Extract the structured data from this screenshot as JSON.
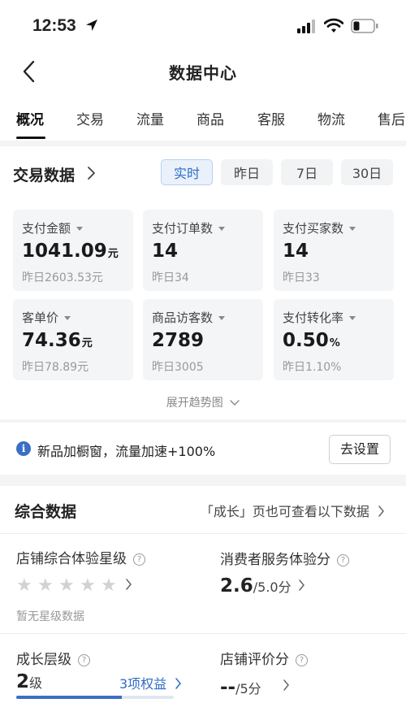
{
  "status_bar": {
    "time": "12:53"
  },
  "header": {
    "title": "数据中心"
  },
  "tabs": [
    {
      "label": "概况",
      "active": true
    },
    {
      "label": "交易",
      "active": false
    },
    {
      "label": "流量",
      "active": false
    },
    {
      "label": "商品",
      "active": false
    },
    {
      "label": "客服",
      "active": false
    },
    {
      "label": "物流",
      "active": false
    },
    {
      "label": "售后",
      "active": false
    }
  ],
  "trade": {
    "title": "交易数据",
    "ranges": [
      "实时",
      "昨日",
      "7日",
      "30日"
    ],
    "active_range": "实时",
    "metrics": [
      {
        "label": "支付金额",
        "value": "1041.09",
        "unit": "元",
        "prev": "昨日2603.53元"
      },
      {
        "label": "支付订单数",
        "value": "14",
        "unit": "",
        "prev": "昨日34"
      },
      {
        "label": "支付买家数",
        "value": "14",
        "unit": "",
        "prev": "昨日33"
      },
      {
        "label": "客单价",
        "value": "74.36",
        "unit": "元",
        "prev": "昨日78.89元"
      },
      {
        "label": "商品访客数",
        "value": "2789",
        "unit": "",
        "prev": "昨日3005"
      },
      {
        "label": "支付转化率",
        "value": "0.50",
        "unit": "%",
        "prev": "昨日1.10%"
      }
    ],
    "expand_label": "展开趋势图"
  },
  "notice": {
    "icon": "info-icon",
    "text": "新品加橱窗，流量加速+100%",
    "button": "去设置"
  },
  "overall": {
    "title": "综合数据",
    "hint": "「成长」页也可查看以下数据",
    "shop_rating": {
      "label": "店铺综合体验星级",
      "stars": 0,
      "max_stars": 5,
      "note": "暂无星级数据"
    },
    "service_score": {
      "label": "消费者服务体验分",
      "value": "2.6",
      "unit": "/5.0分"
    },
    "growth": {
      "label": "成长层级",
      "level": "2",
      "unit": "级",
      "benefits": "3项权益",
      "progress": 0.67
    },
    "review_score": {
      "label": "店铺评价分",
      "value": "--",
      "unit": "/5分"
    }
  },
  "colors": {
    "accent": "#3a6fc4",
    "background": "#f4f4f5"
  }
}
